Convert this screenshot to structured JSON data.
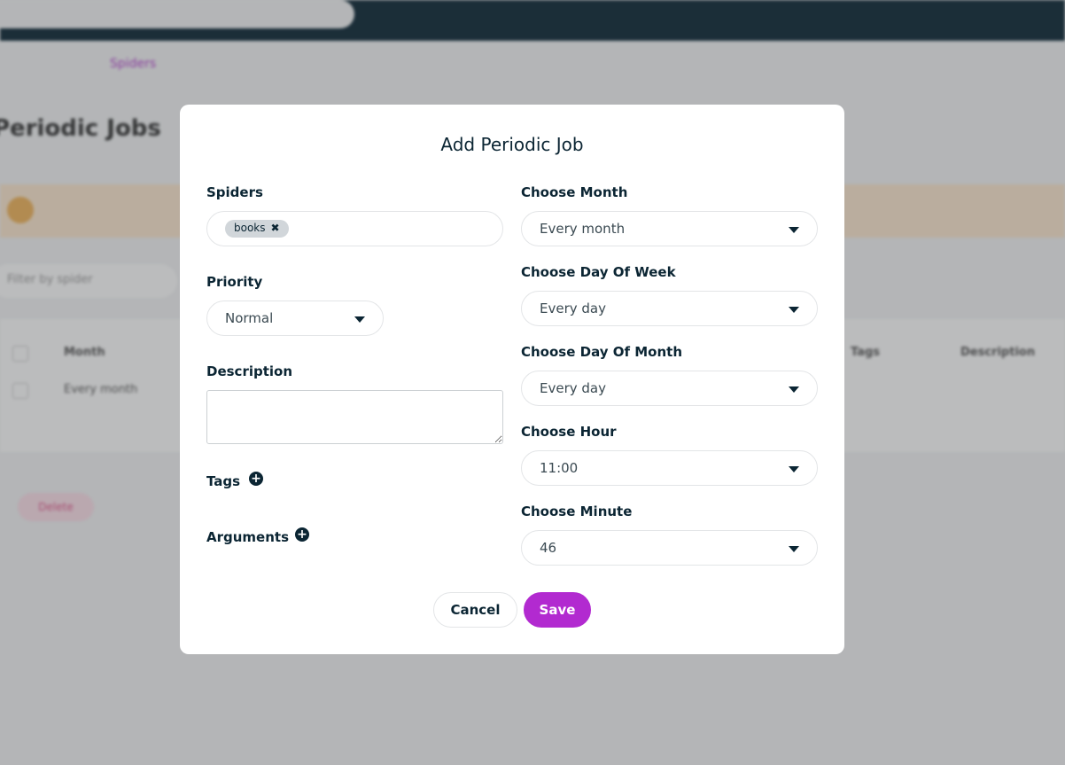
{
  "background": {
    "breadcrumb": {
      "current": "Spiders"
    },
    "page_title": "Periodic Jobs",
    "filter_placeholder": "Filter by spider",
    "table": {
      "headers": [
        "Month",
        "Tags",
        "Description"
      ],
      "rows": [
        [
          "Every month"
        ]
      ]
    },
    "delete_label": "Delete"
  },
  "modal": {
    "title": "Add Periodic Job",
    "spiders": {
      "label": "Spiders",
      "chips": [
        "books"
      ]
    },
    "priority": {
      "label": "Priority",
      "value": "Normal"
    },
    "description": {
      "label": "Description",
      "value": ""
    },
    "tags": {
      "label": "Tags"
    },
    "arguments": {
      "label": "Arguments"
    },
    "month": {
      "label": "Choose Month",
      "value": "Every month"
    },
    "day_of_week": {
      "label": "Choose Day Of Week",
      "value": "Every day"
    },
    "day_of_month": {
      "label": "Choose Day Of Month",
      "value": "Every day"
    },
    "hour": {
      "label": "Choose Hour",
      "value": "11:00"
    },
    "minute": {
      "label": "Choose Minute",
      "value": "46"
    },
    "cancel_label": "Cancel",
    "save_label": "Save"
  },
  "colors": {
    "accent": "#b22ad0",
    "topbar": "#0a2534",
    "text": "#0b2533"
  }
}
